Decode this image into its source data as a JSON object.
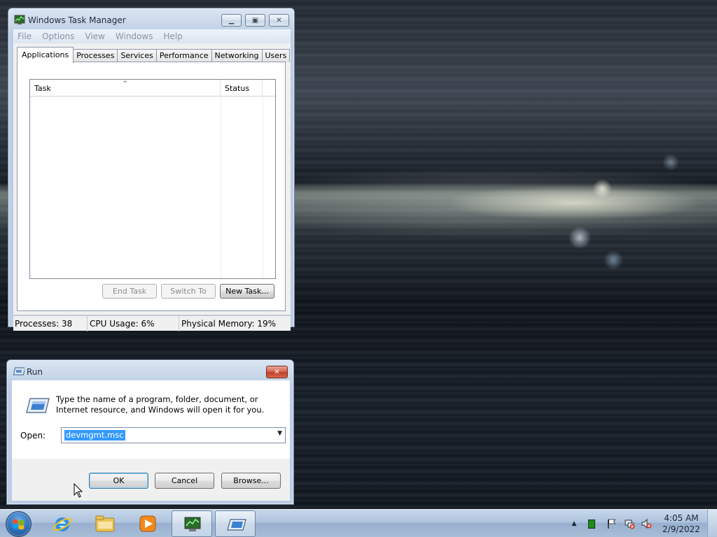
{
  "task_manager": {
    "title": "Windows Task Manager",
    "menu": [
      "File",
      "Options",
      "View",
      "Windows",
      "Help"
    ],
    "tabs": [
      "Applications",
      "Processes",
      "Services",
      "Performance",
      "Networking",
      "Users"
    ],
    "active_tab": "Applications",
    "columns": [
      "Task",
      "Status"
    ],
    "buttons": {
      "end_task": "End Task",
      "switch_to": "Switch To",
      "new_task": "New Task..."
    },
    "status": {
      "processes": "Processes: 38",
      "cpu": "CPU Usage: 6%",
      "memory": "Physical Memory: 19%"
    }
  },
  "run_dialog": {
    "title": "Run",
    "description": "Type the name of a program, folder, document, or Internet resource, and Windows will open it for you.",
    "open_label": "Open:",
    "open_value": "devmgmt.msc",
    "buttons": {
      "ok": "OK",
      "cancel": "Cancel",
      "browse": "Browse..."
    }
  },
  "taskbar": {
    "pinned": [
      "internet-explorer",
      "windows-explorer",
      "windows-media-player",
      "task-manager",
      "run"
    ],
    "active": [
      "task-manager",
      "run"
    ],
    "clock_time": "4:05 AM",
    "clock_date": "2/9/2022"
  },
  "colors": {
    "selection": "#3399ff",
    "close_button": "#c33d26",
    "window_frame": "#bccde4"
  }
}
